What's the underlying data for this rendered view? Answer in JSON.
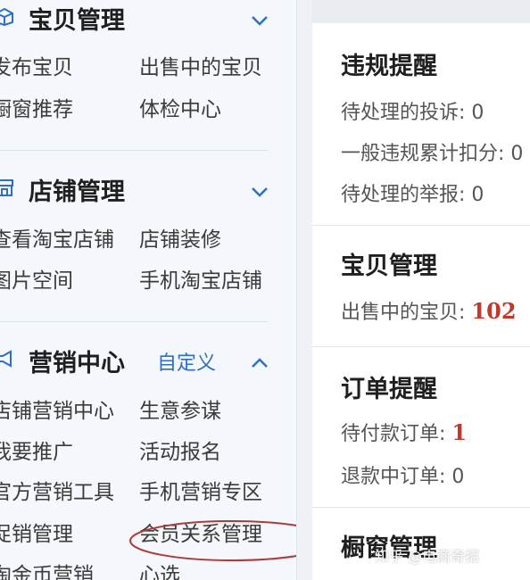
{
  "sidebar": {
    "sections": [
      {
        "title": "宝贝管理",
        "custom": "",
        "expanded": false,
        "links": [
          "发布宝贝",
          "出售中的宝贝",
          "橱窗推荐",
          "体检中心"
        ]
      },
      {
        "title": "店铺管理",
        "custom": "",
        "expanded": false,
        "links": [
          "查看淘宝店铺",
          "店铺装修",
          "图片空间",
          "手机淘宝店铺"
        ]
      },
      {
        "title": "营销中心",
        "custom": "自定义",
        "expanded": true,
        "links": [
          "店铺营销中心",
          "生意参谋",
          "我要推广",
          "活动报名",
          "官方营销工具",
          "手机营销专区",
          "促销管理",
          "会员关系管理",
          "淘金币营销",
          "心选"
        ]
      }
    ]
  },
  "panel": {
    "cards": [
      {
        "title": "违规提醒",
        "rows": [
          {
            "label": "待处理的投诉:",
            "value": "0"
          },
          {
            "label": "一般违规累计扣分:",
            "value": "0"
          },
          {
            "label": "待处理的举报:",
            "value": "0"
          }
        ]
      },
      {
        "title": "宝贝管理",
        "rows": [
          {
            "label": "出售中的宝贝:",
            "value": "102"
          }
        ]
      },
      {
        "title": "订单提醒",
        "rows": [
          {
            "label": "待付款订单:",
            "value": "1"
          },
          {
            "label": "退款中订单:",
            "value": "0"
          }
        ]
      },
      {
        "title": "橱窗管理",
        "rows": []
      }
    ]
  },
  "watermark": "知乎 @电商奇招",
  "colors": {
    "sidebar_bg": "#f4f7fb",
    "accent_blue": "#2f6ec4",
    "highlight_red": "#c0392b",
    "annotation_circle": "#b03a3a"
  }
}
